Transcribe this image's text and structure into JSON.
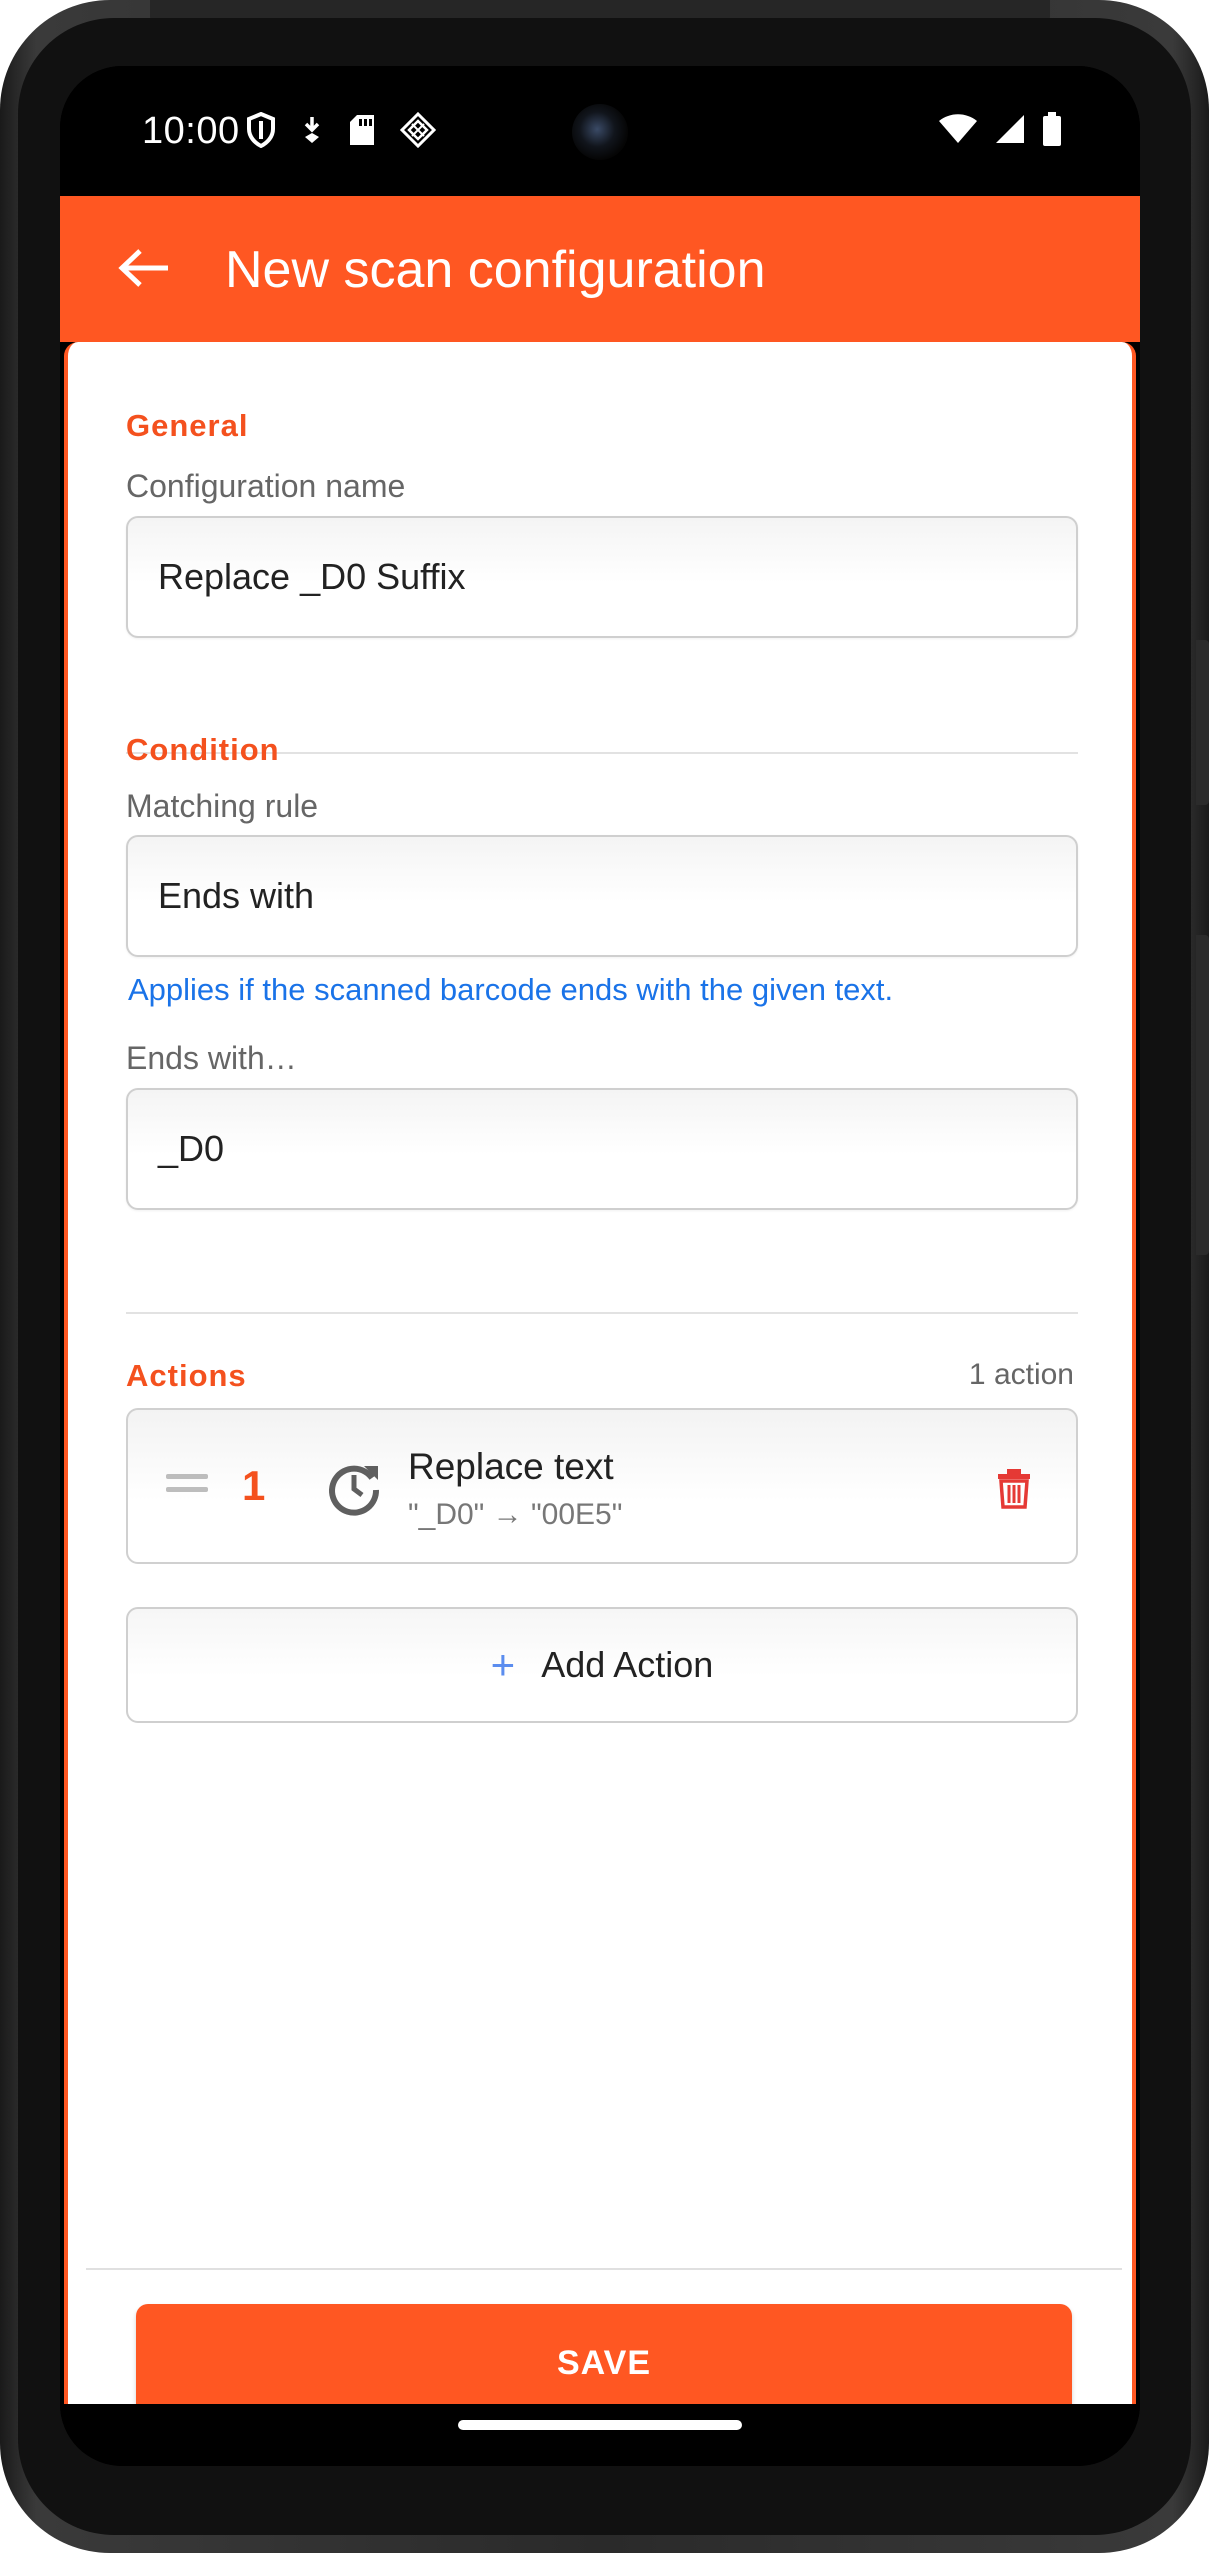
{
  "status_bar": {
    "time": "10:00",
    "left_icons": [
      "shield-icon",
      "download-icon",
      "sd-card-icon",
      "cast-diamond-icon"
    ],
    "right_icons": [
      "wifi-icon",
      "signal-icon",
      "battery-icon"
    ]
  },
  "app_bar": {
    "title": "New scan configuration",
    "back_icon": "arrow-left-icon",
    "color": "#FF5722"
  },
  "general": {
    "section_title": "General",
    "name_label": "Configuration name",
    "name_value": "Replace _D0 Suffix"
  },
  "condition": {
    "section_title": "Condition",
    "rule_label": "Matching rule",
    "rule_value": "Ends with",
    "rule_helper": "Applies if the scanned barcode ends with the given text.",
    "text_label": "Ends with…",
    "text_value": "_D0"
  },
  "actions": {
    "section_title": "Actions",
    "count_text": "1 action",
    "items": [
      {
        "number": "1",
        "icon": "replace-icon",
        "title": "Replace text",
        "subtitle": "\"_D0\" → \"00E5\""
      }
    ],
    "add_label": "Add Action"
  },
  "save_label": "SAVE",
  "colors": {
    "accent": "#FF5722",
    "section_title": "#F4511E",
    "helper_text": "#1A73E8",
    "delete": "#E53935"
  }
}
